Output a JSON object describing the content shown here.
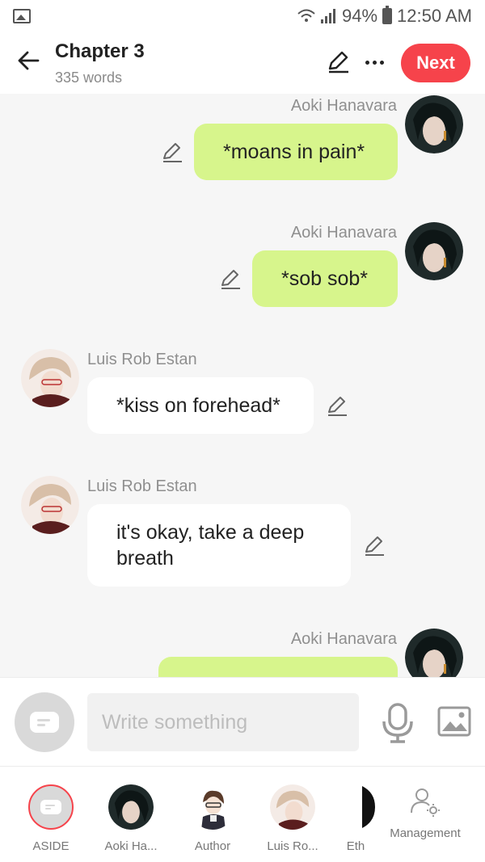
{
  "status_bar": {
    "battery": "94%",
    "time": "12:50 AM"
  },
  "header": {
    "title": "Chapter 3",
    "word_count": "335 words",
    "next_label": "Next"
  },
  "messages": [
    {
      "speaker": "Aoki Hanavara",
      "text": "*moans in pain*",
      "side": "right"
    },
    {
      "speaker": "Aoki Hanavara",
      "text": "*sob sob*",
      "side": "right"
    },
    {
      "speaker": "Luis Rob Estan",
      "text": "*kiss on forehead*",
      "side": "left"
    },
    {
      "speaker": "Luis Rob Estan",
      "text": "it's okay, take a deep breath",
      "side": "left"
    },
    {
      "speaker": "Aoki Hanavara",
      "text": "",
      "side": "right"
    }
  ],
  "composer": {
    "placeholder": "Write something"
  },
  "characters": [
    {
      "label": "ASIDE"
    },
    {
      "label": "Aoki Ha..."
    },
    {
      "label": "Author"
    },
    {
      "label": "Luis Ro..."
    },
    {
      "label": "Eth"
    }
  ],
  "management_label": "Management",
  "colors": {
    "accent": "#f6434b",
    "my_bubble": "#d7f58c",
    "their_bubble": "#ffffff",
    "background": "#f6f6f6"
  }
}
